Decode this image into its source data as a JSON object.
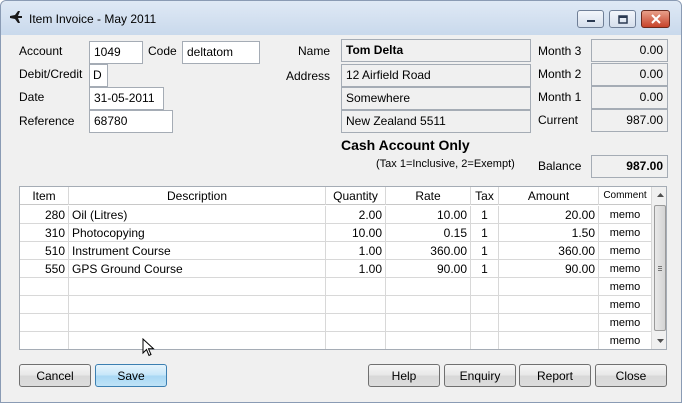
{
  "window": {
    "title": "Item Invoice - May 2011"
  },
  "labels": {
    "account": "Account",
    "code": "Code",
    "debit_credit": "Debit/Credit",
    "date": "Date",
    "reference": "Reference",
    "name": "Name",
    "address": "Address",
    "month3": "Month 3",
    "month2": "Month 2",
    "month1": "Month 1",
    "current": "Current",
    "balance": "Balance"
  },
  "fields": {
    "account": "1049",
    "code": "deltatom",
    "debit_credit": "D",
    "date": "31-05-2011",
    "reference": "68780",
    "name": "Tom Delta",
    "address1": "12 Airfield Road",
    "address2": "Somewhere",
    "address3": "New Zealand 5511",
    "month3": "0.00",
    "month2": "0.00",
    "month1": "0.00",
    "current": "987.00",
    "balance": "987.00"
  },
  "notices": {
    "cash_account": "Cash Account Only",
    "tax_note": "(Tax 1=Inclusive, 2=Exempt)"
  },
  "grid": {
    "columns": [
      "Item",
      "Description",
      "Quantity",
      "Rate",
      "Tax",
      "Amount",
      "Comment"
    ],
    "rows": [
      {
        "item": "280",
        "description": "Oil (Litres)",
        "quantity": "2.00",
        "rate": "10.00",
        "tax": "1",
        "amount": "20.00",
        "comment": "memo"
      },
      {
        "item": "310",
        "description": "Photocopying",
        "quantity": "10.00",
        "rate": "0.15",
        "tax": "1",
        "amount": "1.50",
        "comment": "memo"
      },
      {
        "item": "510",
        "description": "Instrument Course",
        "quantity": "1.00",
        "rate": "360.00",
        "tax": "1",
        "amount": "360.00",
        "comment": "memo"
      },
      {
        "item": "550",
        "description": "GPS Ground Course",
        "quantity": "1.00",
        "rate": "90.00",
        "tax": "1",
        "amount": "90.00",
        "comment": "memo"
      },
      {
        "item": "",
        "description": "",
        "quantity": "",
        "rate": "",
        "tax": "",
        "amount": "",
        "comment": "memo"
      },
      {
        "item": "",
        "description": "",
        "quantity": "",
        "rate": "",
        "tax": "",
        "amount": "",
        "comment": "memo"
      },
      {
        "item": "",
        "description": "",
        "quantity": "",
        "rate": "",
        "tax": "",
        "amount": "",
        "comment": "memo"
      },
      {
        "item": "",
        "description": "",
        "quantity": "",
        "rate": "",
        "tax": "",
        "amount": "",
        "comment": "memo"
      }
    ]
  },
  "buttons": {
    "cancel": "Cancel",
    "save": "Save",
    "help": "Help",
    "enquiry": "Enquiry",
    "report": "Report",
    "close": "Close"
  },
  "icons": {
    "app": "airplane-icon",
    "minimize": "minimize-icon",
    "maximize": "maximize-icon",
    "close": "close-icon"
  }
}
